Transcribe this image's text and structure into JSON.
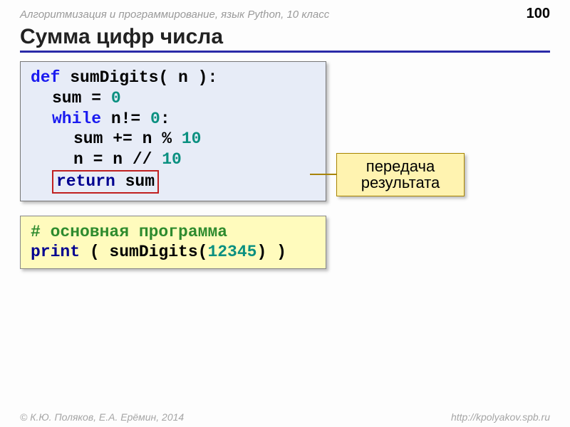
{
  "header": {
    "title": "Алгоритмизация и программирование, язык Python, 10 класс",
    "page": "100"
  },
  "title": "Сумма цифр числа",
  "code1": {
    "l1_def": "def",
    "l1_rest": " sumDigits( n ):",
    "l2_a": "sum = ",
    "l2_zero": "0",
    "l3_while": "while",
    "l3_mid": " n!= ",
    "l3_zero": "0",
    "l3_colon": ":",
    "l4_a": "sum += n % ",
    "l4_ten": "10",
    "l5_a": "n = n // ",
    "l5_ten": "10",
    "l6_return": "return",
    "l6_sum": " sum"
  },
  "callout": {
    "line1": "передача",
    "line2": "результата"
  },
  "code2": {
    "comment": "# основная программа",
    "l2_print": "print",
    "l2_open": " ( sumDigits(",
    "l2_num": "12345",
    "l2_close": ") )"
  },
  "footer": {
    "left": "© К.Ю. Поляков, Е.А. Ерёмин, 2014",
    "right": "http://kpolyakov.spb.ru"
  }
}
